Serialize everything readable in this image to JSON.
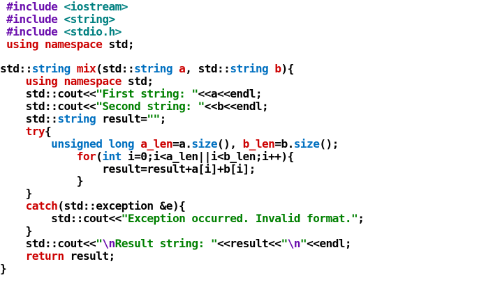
{
  "colors": {
    "background": "#ffffff",
    "keyword": "#6a0dad",
    "preprocessor": "#0070c0",
    "string": "#008000",
    "type": "#0070c0",
    "identifier": "#000000",
    "red_keyword": "#cc0000",
    "function": "#8b008b"
  },
  "code_lines": [
    [
      {
        "t": " #include ",
        "c": "#6a0dad"
      },
      {
        "t": "<iostream>",
        "c": "#008080"
      }
    ],
    [
      {
        "t": " #include ",
        "c": "#6a0dad"
      },
      {
        "t": "<string>",
        "c": "#008080"
      }
    ],
    [
      {
        "t": " #include ",
        "c": "#6a0dad"
      },
      {
        "t": "<stdio.h>",
        "c": "#008080"
      }
    ],
    [
      {
        "t": " using namespace ",
        "c": "#cc0000"
      },
      {
        "t": "std;",
        "c": "#000000"
      }
    ],
    [
      {
        "t": "",
        "c": "#000000"
      }
    ],
    [
      {
        "t": "std::",
        "c": "#000000"
      },
      {
        "t": "string",
        "c": "#0070c0"
      },
      {
        "t": " ",
        "c": "#000000"
      },
      {
        "t": "mix",
        "c": "#cc0000"
      },
      {
        "t": "(",
        "c": "#000000"
      },
      {
        "t": "std::",
        "c": "#000000"
      },
      {
        "t": "string",
        "c": "#0070c0"
      },
      {
        "t": " ",
        "c": "#000000"
      },
      {
        "t": "a",
        "c": "#cc0000"
      },
      {
        "t": ", ",
        "c": "#000000"
      },
      {
        "t": "std::",
        "c": "#000000"
      },
      {
        "t": "string",
        "c": "#0070c0"
      },
      {
        "t": " ",
        "c": "#000000"
      },
      {
        "t": "b",
        "c": "#cc0000"
      },
      {
        "t": "){",
        "c": "#000000"
      }
    ],
    [
      {
        "t": "    using namespace ",
        "c": "#cc0000"
      },
      {
        "t": "std;",
        "c": "#000000"
      }
    ],
    [
      {
        "t": "    std::cout<<",
        "c": "#000000"
      },
      {
        "t": "\"First string: \"",
        "c": "#008000"
      },
      {
        "t": "<<a<<endl;",
        "c": "#000000"
      }
    ],
    [
      {
        "t": "    std::cout<<",
        "c": "#000000"
      },
      {
        "t": "\"Second string: \"",
        "c": "#008000"
      },
      {
        "t": "<<b<<endl;",
        "c": "#000000"
      }
    ],
    [
      {
        "t": "    std::",
        "c": "#000000"
      },
      {
        "t": "string",
        "c": "#0070c0"
      },
      {
        "t": " result=",
        "c": "#000000"
      },
      {
        "t": "\"\"",
        "c": "#008000"
      },
      {
        "t": ";",
        "c": "#000000"
      }
    ],
    [
      {
        "t": "    ",
        "c": "#000000"
      },
      {
        "t": "try",
        "c": "#cc0000"
      },
      {
        "t": "{",
        "c": "#000000"
      }
    ],
    [
      {
        "t": "        ",
        "c": "#000000"
      },
      {
        "t": "unsigned long",
        "c": "#0070c0"
      },
      {
        "t": " ",
        "c": "#000000"
      },
      {
        "t": "a_len",
        "c": "#cc0000"
      },
      {
        "t": "=a.",
        "c": "#000000"
      },
      {
        "t": "size",
        "c": "#0070c0"
      },
      {
        "t": "(), ",
        "c": "#000000"
      },
      {
        "t": "b_len",
        "c": "#cc0000"
      },
      {
        "t": "=b.",
        "c": "#000000"
      },
      {
        "t": "size",
        "c": "#0070c0"
      },
      {
        "t": "();",
        "c": "#000000"
      }
    ],
    [
      {
        "t": "            ",
        "c": "#000000"
      },
      {
        "t": "for",
        "c": "#cc0000"
      },
      {
        "t": "(",
        "c": "#000000"
      },
      {
        "t": "int",
        "c": "#0070c0"
      },
      {
        "t": " i=0;i<a_len||i<b_len;i++){",
        "c": "#000000"
      }
    ],
    [
      {
        "t": "                result=result+a[i]+b[i];",
        "c": "#000000"
      }
    ],
    [
      {
        "t": "            }",
        "c": "#000000"
      }
    ],
    [
      {
        "t": "    }",
        "c": "#000000"
      }
    ],
    [
      {
        "t": "    ",
        "c": "#000000"
      },
      {
        "t": "catch",
        "c": "#cc0000"
      },
      {
        "t": "(std::exception &e){",
        "c": "#000000"
      }
    ],
    [
      {
        "t": "        std::cout<<",
        "c": "#000000"
      },
      {
        "t": "\"Exception occurred. Invalid format.\"",
        "c": "#008000"
      },
      {
        "t": ";",
        "c": "#000000"
      }
    ],
    [
      {
        "t": "    }",
        "c": "#000000"
      }
    ],
    [
      {
        "t": "    std::cout<<",
        "c": "#000000"
      },
      {
        "t": "\"",
        "c": "#008000"
      },
      {
        "t": "\\n",
        "c": "#6a0dad"
      },
      {
        "t": "Result string: \"",
        "c": "#008000"
      },
      {
        "t": "<<result<<",
        "c": "#000000"
      },
      {
        "t": "\"",
        "c": "#008000"
      },
      {
        "t": "\\n",
        "c": "#6a0dad"
      },
      {
        "t": "\"",
        "c": "#008000"
      },
      {
        "t": "<<endl;",
        "c": "#000000"
      }
    ],
    [
      {
        "t": "    ",
        "c": "#000000"
      },
      {
        "t": "return",
        "c": "#cc0000"
      },
      {
        "t": " result;",
        "c": "#000000"
      }
    ],
    [
      {
        "t": "}",
        "c": "#000000"
      }
    ]
  ]
}
